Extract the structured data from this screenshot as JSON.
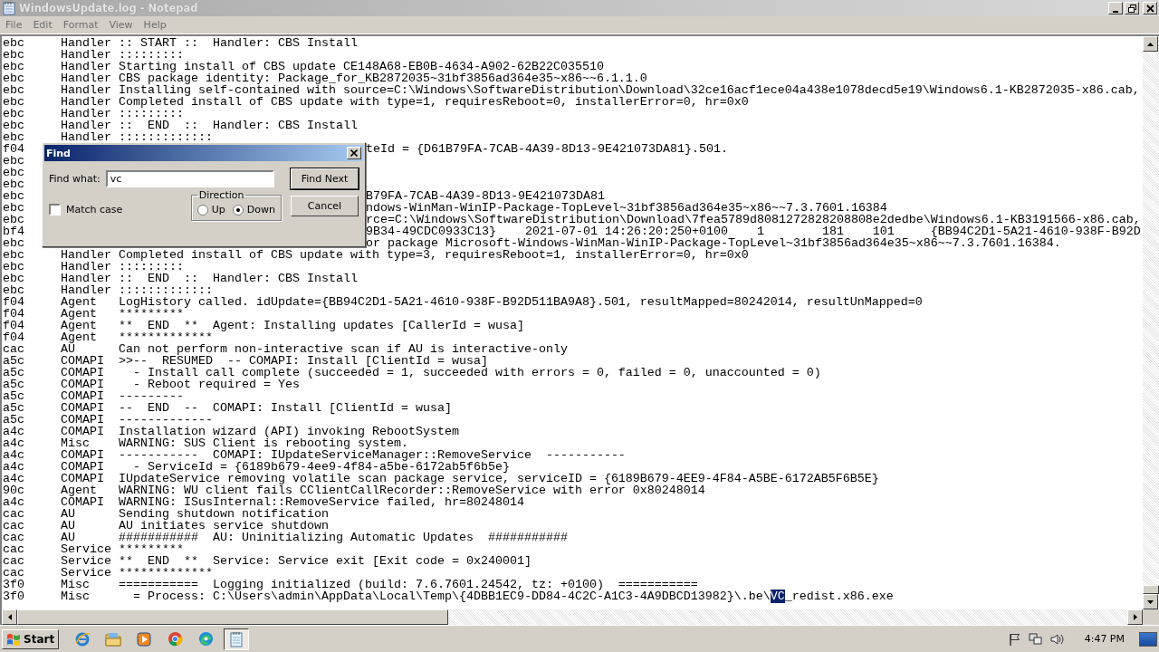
{
  "window": {
    "title": "WindowsUpdate.log - Notepad"
  },
  "menu": [
    "File",
    "Edit",
    "Format",
    "View",
    "Help"
  ],
  "log_lines": [
    {
      "kind": "entry",
      "thread": "ebc",
      "component": "Handler",
      "message": ":: START ::  Handler: CBS Install"
    },
    {
      "kind": "entry",
      "thread": "ebc",
      "component": "Handler",
      "message": ":::::::::"
    },
    {
      "kind": "entry",
      "thread": "ebc",
      "component": "Handler",
      "message": "Starting install of CBS update CE148A68-EB0B-4634-A902-62B22C035510"
    },
    {
      "kind": "entry",
      "thread": "ebc",
      "component": "Handler",
      "message": "CBS package identity: Package_for_KB2872035~31bf3856ad364e35~x86~~6.1.1.0"
    },
    {
      "kind": "entry",
      "thread": "ebc",
      "component": "Handler",
      "message": "Installing self-contained with source=C:\\Windows\\SoftwareDistribution\\Download\\32ce16acf1ece04a438e1078decd5e19\\Windows6.1-KB2872035-x86.cab,"
    },
    {
      "kind": "entry",
      "thread": "ebc",
      "component": "Handler",
      "message": "Completed install of CBS update with type=1, requiresReboot=0, installerError=0, hr=0x0"
    },
    {
      "kind": "entry",
      "thread": "ebc",
      "component": "Handler",
      "message": ":::::::::"
    },
    {
      "kind": "entry",
      "thread": "ebc",
      "component": "Handler",
      "message": "::  END  ::  Handler: CBS Install"
    },
    {
      "kind": "entry",
      "thread": "ebc",
      "component": "Handler",
      "message": ":::::::::::::"
    },
    {
      "kind": "covered",
      "thread": "f04",
      "tail": "teId = {D61B79FA-7CAB-4A39-8D13-9E421073DA81}.501."
    },
    {
      "kind": "covered",
      "thread": "ebc"
    },
    {
      "kind": "covered",
      "thread": "ebc"
    },
    {
      "kind": "covered",
      "thread": "ebc"
    },
    {
      "kind": "covered",
      "thread": "ebc",
      "tail": "B79FA-7CAB-4A39-8D13-9E421073DA81"
    },
    {
      "kind": "covered",
      "thread": "ebc",
      "tail": "ndows-WinMan-WinIP-Package-TopLevel~31bf3856ad364e35~x86~~7.3.7601.16384"
    },
    {
      "kind": "covered",
      "thread": "ebc",
      "tail": "rce=C:\\Windows\\SoftwareDistribution\\Download\\7fea5789d8081272828208808e2dedbe\\Windows6.1-KB3191566-x86.cab,"
    },
    {
      "kind": "covered",
      "thread": "bf4",
      "tail": "9B34-49CDC0933C13}    2021-07-01 14:26:20:250+0100    1        181    101     {BB94C2D1-5A21-4610-938F-B92D"
    },
    {
      "kind": "covered",
      "thread": "ebc",
      "tail": "or package Microsoft-Windows-WinMan-WinIP-Package-TopLevel~31bf3856ad364e35~x86~~7.3.7601.16384."
    },
    {
      "kind": "entry",
      "thread": "ebc",
      "component": "Handler",
      "message": "Completed install of CBS update with type=3, requiresReboot=1, installerError=0, hr=0x0"
    },
    {
      "kind": "entry",
      "thread": "ebc",
      "component": "Handler",
      "message": ":::::::::"
    },
    {
      "kind": "entry",
      "thread": "ebc",
      "component": "Handler",
      "message": "::  END  ::  Handler: CBS Install"
    },
    {
      "kind": "entry",
      "thread": "ebc",
      "component": "Handler",
      "message": ":::::::::::::"
    },
    {
      "kind": "entry",
      "thread": "f04",
      "component": "Agent",
      "message": "LogHistory called. idUpdate={BB94C2D1-5A21-4610-938F-B92D511BA9A8}.501, resultMapped=80242014, resultUnMapped=0"
    },
    {
      "kind": "entry",
      "thread": "f04",
      "component": "Agent",
      "message": "*********"
    },
    {
      "kind": "entry",
      "thread": "f04",
      "component": "Agent",
      "message": "**  END  **  Agent: Installing updates [CallerId = wusa]"
    },
    {
      "kind": "entry",
      "thread": "f04",
      "component": "Agent",
      "message": "*************"
    },
    {
      "kind": "entry",
      "thread": "cac",
      "component": "AU",
      "message": "Can not perform non-interactive scan if AU is interactive-only"
    },
    {
      "kind": "entry",
      "thread": "a5c",
      "component": "COMAPI",
      "message": ">>--  RESUMED  -- COMAPI: Install [ClientId = wusa]"
    },
    {
      "kind": "entry",
      "thread": "a5c",
      "component": "COMAPI",
      "message": "  - Install call complete (succeeded = 1, succeeded with errors = 0, failed = 0, unaccounted = 0)"
    },
    {
      "kind": "entry",
      "thread": "a5c",
      "component": "COMAPI",
      "message": "  - Reboot required = Yes"
    },
    {
      "kind": "entry",
      "thread": "a5c",
      "component": "COMAPI",
      "message": "---------"
    },
    {
      "kind": "entry",
      "thread": "a5c",
      "component": "COMAPI",
      "message": "--  END  --  COMAPI: Install [ClientId = wusa]"
    },
    {
      "kind": "entry",
      "thread": "a5c",
      "component": "COMAPI",
      "message": "-------------"
    },
    {
      "kind": "entry",
      "thread": "a4c",
      "component": "COMAPI",
      "message": "Installation wizard (API) invoking RebootSystem"
    },
    {
      "kind": "entry",
      "thread": "a4c",
      "component": "Misc",
      "message": "WARNING: SUS Client is rebooting system."
    },
    {
      "kind": "entry",
      "thread": "a4c",
      "component": "COMAPI",
      "message": "-----------  COMAPI: IUpdateServiceManager::RemoveService  -----------"
    },
    {
      "kind": "entry",
      "thread": "a4c",
      "component": "COMAPI",
      "message": "  - ServiceId = {6189b679-4ee9-4f84-a5be-6172ab5f6b5e}"
    },
    {
      "kind": "entry",
      "thread": "a4c",
      "component": "COMAPI",
      "message": "IUpdateService removing volatile scan package service, serviceID = {6189B679-4EE9-4F84-A5BE-6172AB5F6B5E}"
    },
    {
      "kind": "entry",
      "thread": "90c",
      "component": "Agent",
      "message": "WARNING: WU client fails CClientCallRecorder::RemoveService with error 0x80248014"
    },
    {
      "kind": "entry",
      "thread": "a4c",
      "component": "COMAPI",
      "message": "WARNING: ISusInternal::RemoveService failed, hr=80248014"
    },
    {
      "kind": "entry",
      "thread": "cac",
      "component": "AU",
      "message": "Sending shutdown notification"
    },
    {
      "kind": "entry",
      "thread": "cac",
      "component": "AU",
      "message": "AU initiates service shutdown"
    },
    {
      "kind": "entry",
      "thread": "cac",
      "component": "AU",
      "message": "###########  AU: Uninitializing Automatic Updates  ###########"
    },
    {
      "kind": "entry",
      "thread": "cac",
      "component": "Service",
      "message": "*********"
    },
    {
      "kind": "entry",
      "thread": "cac",
      "component": "Service",
      "message": "**  END  **  Service: Service exit [Exit code = 0x240001]"
    },
    {
      "kind": "entry",
      "thread": "cac",
      "component": "Service",
      "message": "*************"
    },
    {
      "kind": "entry",
      "thread": "3f0",
      "component": "Misc",
      "message": "===========  Logging initialized (build: 7.6.7601.24542, tz: +0100)  ==========="
    },
    {
      "kind": "entry",
      "thread": "3f0",
      "component": "Misc",
      "message": "  = Process: C:\\Users\\admin\\AppData\\Local\\Temp\\{4DBB1EC9-DD84-4C2C-A1C3-4A9DBCD13982}\\.be\\",
      "selection": "VC",
      "message_end": "_redist.x86.exe"
    }
  ],
  "find_dialog": {
    "title": "Find",
    "find_what_label": "Find what:",
    "find_what_value": "vc",
    "buttons": [
      "Find Next",
      "Cancel"
    ],
    "direction": {
      "label": "Direction",
      "options": [
        {
          "label": "Up",
          "selected": false
        },
        {
          "label": "Down",
          "selected": true
        }
      ]
    },
    "match_case": {
      "label": "Match case",
      "checked": false
    }
  },
  "taskbar": {
    "start": "Start",
    "apps": [
      {
        "kind": "ie",
        "selected": false
      },
      {
        "kind": "folder",
        "selected": false
      },
      {
        "kind": "media",
        "selected": false
      },
      {
        "kind": "chrome",
        "selected": false
      },
      {
        "kind": "edge",
        "selected": false
      },
      {
        "kind": "notepad",
        "selected": true
      }
    ],
    "clock": "4:47 PM"
  }
}
